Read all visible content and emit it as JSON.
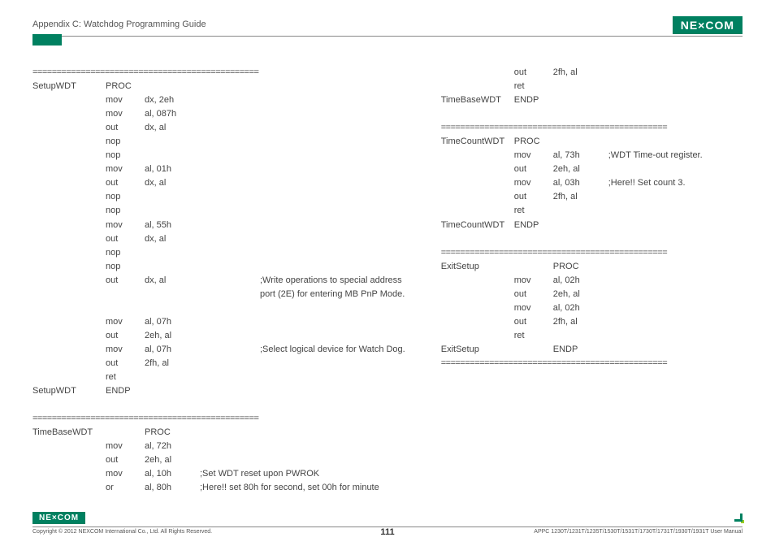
{
  "header": {
    "title": "Appendix C: Watchdog Programming Guide",
    "logo": "NE×COM"
  },
  "separator": "===============================================",
  "code_left": [
    {
      "sep": true
    },
    {
      "lab": "SetupWDT",
      "op": "PROC"
    },
    {
      "lab": "",
      "op": "mov",
      "arg": "dx, 2eh"
    },
    {
      "lab": "",
      "op": "mov",
      "arg": "al, 087h"
    },
    {
      "lab": "",
      "op": "out",
      "arg": "dx, al"
    },
    {
      "lab": "",
      "op": "nop"
    },
    {
      "lab": "",
      "op": "nop"
    },
    {
      "lab": "",
      "op": "mov",
      "arg": "al, 01h"
    },
    {
      "lab": "",
      "op": "out",
      "arg": "dx, al"
    },
    {
      "lab": "",
      "op": "nop"
    },
    {
      "lab": "",
      "op": "nop"
    },
    {
      "lab": "",
      "op": "mov",
      "arg": "al, 55h"
    },
    {
      "lab": "",
      "op": "out",
      "arg": "dx, al"
    },
    {
      "lab": "",
      "op": "nop"
    },
    {
      "lab": "",
      "op": "nop"
    },
    {
      "lab": "",
      "op": "out",
      "arg": "dx, al",
      "cmt": ";Write operations to special address"
    },
    {
      "lab": "",
      "op": "",
      "arg": "",
      "cmt": "port (2E) for entering MB PnP Mode."
    },
    {
      "blank": true
    },
    {
      "lab": "",
      "op": "mov",
      "arg": "al, 07h"
    },
    {
      "lab": "",
      "op": "out",
      "arg": "2eh, al"
    },
    {
      "lab": "",
      "op": "mov",
      "arg": "al, 07h",
      "cmt": ";Select logical device for Watch Dog."
    },
    {
      "lab": "",
      "op": "out",
      "arg": "2fh, al"
    },
    {
      "lab": "",
      "op": "ret"
    },
    {
      "lab": "SetupWDT",
      "op": "ENDP"
    },
    {
      "blank": true
    },
    {
      "sep": true
    },
    {
      "lab": "TimeBaseWDT",
      "op": "",
      "arg": "PROC"
    },
    {
      "lab": "",
      "op": "mov",
      "arg": "al, 72h"
    },
    {
      "lab": "",
      "op": "out",
      "arg": "2eh, al"
    },
    {
      "lab": "",
      "op": "mov",
      "arg": "al, 10h",
      "cmt_tight": ";Set WDT reset upon PWROK"
    },
    {
      "lab": "",
      "op": "or",
      "arg": "al, 80h",
      "cmt_tight": ";Here!! set 80h for second, set 00h for minute"
    }
  ],
  "code_right": [
    {
      "lab": "",
      "op": "out",
      "arg": "2fh, al"
    },
    {
      "lab": "",
      "op": "ret"
    },
    {
      "lab": "TimeBaseWDT",
      "op": "ENDP"
    },
    {
      "blank": true
    },
    {
      "sep": true
    },
    {
      "lab": "TimeCountWDT",
      "op": "PROC"
    },
    {
      "lab": "",
      "op": "mov",
      "arg": "al, 73h",
      "cmt_tight": ";WDT Time-out register."
    },
    {
      "lab": "",
      "op": "out",
      "arg": "2eh, al"
    },
    {
      "lab": "",
      "op": "mov",
      "arg": "al, 03h",
      "cmt_tight": ";Here!! Set count 3."
    },
    {
      "lab": "",
      "op": "out",
      "arg": "2fh, al"
    },
    {
      "lab": "",
      "op": "ret"
    },
    {
      "lab": "TimeCountWDT",
      "op": "ENDP"
    },
    {
      "blank": true
    },
    {
      "sep": true
    },
    {
      "lab": "ExitSetup",
      "op": "",
      "arg": "PROC"
    },
    {
      "lab": "",
      "op": "mov",
      "arg": "al, 02h"
    },
    {
      "lab": "",
      "op": "out",
      "arg": "2eh, al"
    },
    {
      "lab": "",
      "op": "mov",
      "arg": "al, 02h"
    },
    {
      "lab": "",
      "op": "out",
      "arg": "2fh, al"
    },
    {
      "lab": "",
      "op": "ret"
    },
    {
      "lab": "ExitSetup",
      "op": "",
      "arg": "ENDP"
    },
    {
      "sep": true
    }
  ],
  "footer": {
    "logo": "NE×COM",
    "copyright": "Copyright © 2012 NEXCOM International Co., Ltd. All Rights Reserved.",
    "page": "111",
    "manual": "APPC 1230T/1231T/1235T/1530T/1531T/1730T/1731T/1930T/1931T User Manual"
  }
}
